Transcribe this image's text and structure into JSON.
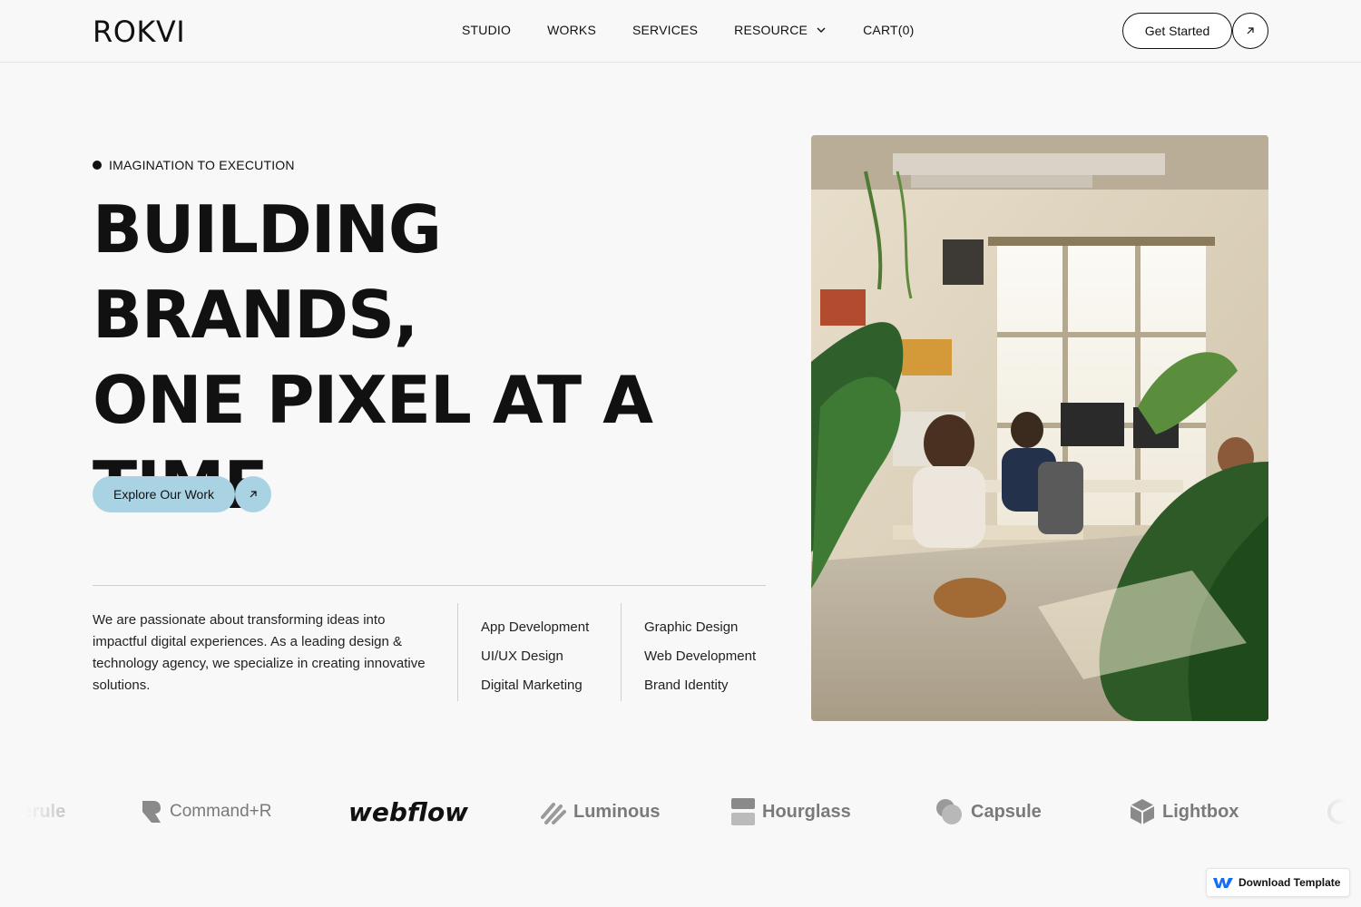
{
  "header": {
    "logo": "ROKVI",
    "nav": [
      {
        "label": "STUDIO"
      },
      {
        "label": "WORKS"
      },
      {
        "label": "SERVICES"
      },
      {
        "label": "RESOURCE",
        "has_dropdown": true
      },
      {
        "label": "CART(0)"
      }
    ],
    "cta_label": "Get Started"
  },
  "hero": {
    "eyebrow": "IMAGINATION TO EXECUTION",
    "headline_lines": [
      "BUILDING BRANDS,",
      "ONE PIXEL AT A",
      "TIME"
    ],
    "explore_label": "Explore Our Work",
    "about": "We are passionate about transforming ideas into impactful digital experiences. As a leading design & technology agency, we specialize in creating innovative solutions.",
    "services_col1": [
      "App Development",
      "UI/UX Design",
      "Digital Marketing"
    ],
    "services_col2": [
      "Graphic Design",
      "Web Development",
      "Brand Identity"
    ]
  },
  "logos": [
    "pherule",
    "Command+R",
    "webflow",
    "Luminous",
    "Hourglass",
    "Capsule",
    "Lightbox"
  ],
  "badge": {
    "label": "Download Template"
  },
  "colors": {
    "accent": "#a9d3e3",
    "background": "#f8f8f8",
    "text": "#111111"
  }
}
